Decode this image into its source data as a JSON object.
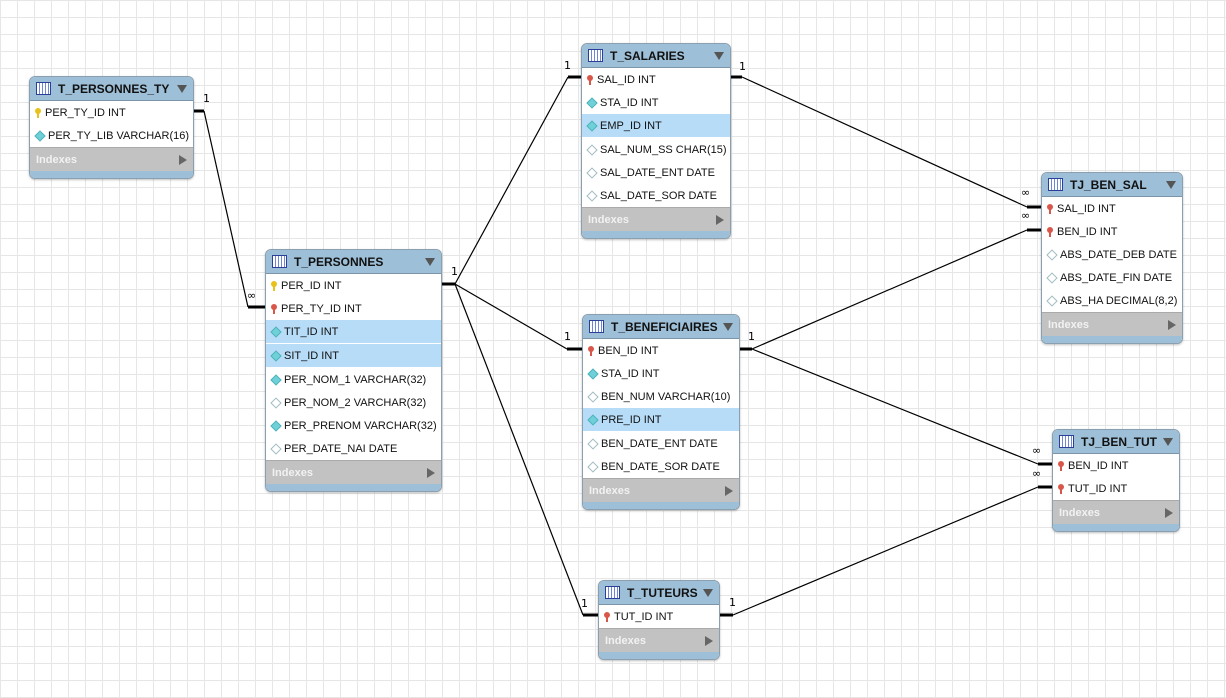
{
  "tables": [
    {
      "id": "t_personnes_ty",
      "name": "T_PERSONNES_TY",
      "indexes_label": "Indexes",
      "columns": [
        {
          "text": "PER_TY_ID INT",
          "icon": "key-yellow"
        },
        {
          "text": "PER_TY_LIB VARCHAR(16)",
          "icon": "dia-filled"
        }
      ]
    },
    {
      "id": "t_personnes",
      "name": "T_PERSONNES",
      "indexes_label": "Indexes",
      "columns": [
        {
          "text": "PER_ID INT",
          "icon": "key-yellow"
        },
        {
          "text": "PER_TY_ID INT",
          "icon": "key-red"
        },
        {
          "text": "TIT_ID INT",
          "icon": "dia-filled",
          "highlighted": true
        },
        {
          "text": "SIT_ID INT",
          "icon": "dia-filled",
          "highlighted": true
        },
        {
          "text": "PER_NOM_1 VARCHAR(32)",
          "icon": "dia-filled"
        },
        {
          "text": "PER_NOM_2 VARCHAR(32)",
          "icon": "dia-empty"
        },
        {
          "text": "PER_PRENOM VARCHAR(32)",
          "icon": "dia-filled"
        },
        {
          "text": "PER_DATE_NAI DATE",
          "icon": "dia-empty"
        }
      ]
    },
    {
      "id": "t_salaries",
      "name": "T_SALARIES",
      "indexes_label": "Indexes",
      "columns": [
        {
          "text": "SAL_ID INT",
          "icon": "key-red"
        },
        {
          "text": "STA_ID INT",
          "icon": "dia-filled"
        },
        {
          "text": "EMP_ID INT",
          "icon": "dia-filled",
          "highlighted": true
        },
        {
          "text": "SAL_NUM_SS CHAR(15)",
          "icon": "dia-empty"
        },
        {
          "text": "SAL_DATE_ENT DATE",
          "icon": "dia-empty"
        },
        {
          "text": "SAL_DATE_SOR DATE",
          "icon": "dia-empty"
        }
      ]
    },
    {
      "id": "t_beneficiaires",
      "name": "T_BENEFICIAIRES",
      "indexes_label": "Indexes",
      "columns": [
        {
          "text": "BEN_ID INT",
          "icon": "key-red"
        },
        {
          "text": "STA_ID INT",
          "icon": "dia-filled"
        },
        {
          "text": "BEN_NUM VARCHAR(10)",
          "icon": "dia-empty"
        },
        {
          "text": "PRE_ID INT",
          "icon": "dia-filled",
          "highlighted": true
        },
        {
          "text": "BEN_DATE_ENT DATE",
          "icon": "dia-empty"
        },
        {
          "text": "BEN_DATE_SOR DATE",
          "icon": "dia-empty"
        }
      ]
    },
    {
      "id": "t_tuteurs",
      "name": "T_TUTEURS",
      "indexes_label": "Indexes",
      "columns": [
        {
          "text": "TUT_ID INT",
          "icon": "key-red"
        }
      ]
    },
    {
      "id": "tj_ben_sal",
      "name": "TJ_BEN_SAL",
      "indexes_label": "Indexes",
      "columns": [
        {
          "text": "SAL_ID INT",
          "icon": "key-red"
        },
        {
          "text": "BEN_ID INT",
          "icon": "key-red"
        },
        {
          "text": "ABS_DATE_DEB DATE",
          "icon": "dia-empty"
        },
        {
          "text": "ABS_DATE_FIN DATE",
          "icon": "dia-empty"
        },
        {
          "text": "ABS_HA DECIMAL(8,2)",
          "icon": "dia-empty"
        }
      ]
    },
    {
      "id": "tj_ben_tut",
      "name": "TJ_BEN_TUT",
      "indexes_label": "Indexes",
      "columns": [
        {
          "text": "BEN_ID INT",
          "icon": "key-red"
        },
        {
          "text": "TUT_ID INT",
          "icon": "key-red"
        }
      ]
    }
  ],
  "relationships": [
    {
      "from": "T_PERSONNES_TY",
      "to": "T_PERSONNES",
      "from_card": "1",
      "to_card": "∞"
    },
    {
      "from": "T_PERSONNES",
      "to": "T_SALARIES",
      "from_card": "1",
      "to_card": "1"
    },
    {
      "from": "T_PERSONNES",
      "to": "T_BENEFICIAIRES",
      "to_card": "1"
    },
    {
      "from": "T_PERSONNES",
      "to": "T_TUTEURS",
      "to_card": "1"
    },
    {
      "from": "T_SALARIES",
      "to": "TJ_BEN_SAL",
      "from_card": "1",
      "to_card": "∞"
    },
    {
      "from": "T_BENEFICIAIRES",
      "to": "TJ_BEN_SAL",
      "from_card": "1",
      "to_card": "∞"
    },
    {
      "from": "T_BENEFICIAIRES",
      "to": "TJ_BEN_TUT",
      "to_card": "∞"
    },
    {
      "from": "T_TUTEURS",
      "to": "TJ_BEN_TUT",
      "from_card": "1",
      "to_card": "∞"
    }
  ]
}
